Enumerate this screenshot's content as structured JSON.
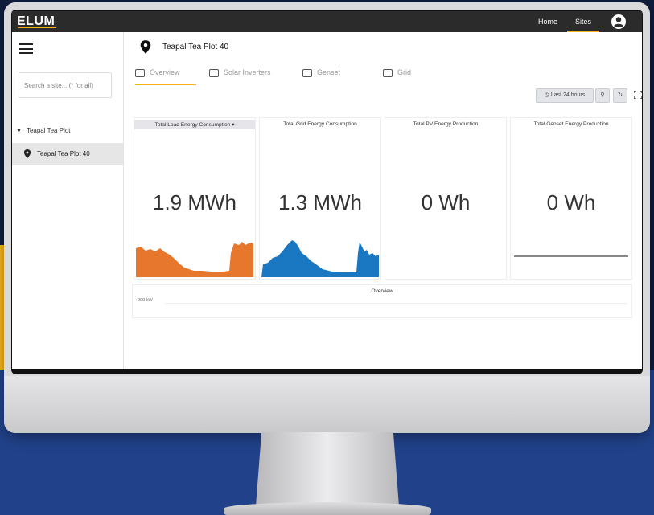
{
  "brand": {
    "logo": "ELUM",
    "accent": "#f6b41c"
  },
  "topnav": {
    "home": "Home",
    "sites": "Sites"
  },
  "sidebar": {
    "search_placeholder": "Search a site... (* for all)",
    "group": "Teapal Tea Plot",
    "item": "Teapal Tea Plot 40"
  },
  "main": {
    "title": "Teapal Tea Plot 40",
    "tabs": [
      {
        "label": "Overview",
        "active": true
      },
      {
        "label": "Solar Inverters",
        "active": false
      },
      {
        "label": "Genset",
        "active": false
      },
      {
        "label": "Grid",
        "active": false
      }
    ],
    "toolbar": {
      "time_range": "Last 24 hours"
    }
  },
  "cards": [
    {
      "title": "Total Load Energy Consumption",
      "value": "1.9 MWh",
      "color": "#e8772e",
      "dropdown": true
    },
    {
      "title": "Total Grid Energy Consumption",
      "value": "1.3 MWh",
      "color": "#1a78c2"
    },
    {
      "title": "Total PV Energy Production",
      "value": "0 Wh"
    },
    {
      "title": "Total Genset Energy Production",
      "value": "0 Wh",
      "color": "#888888"
    }
  ],
  "overview": {
    "title": "Overview",
    "y_tick": "200 kW"
  }
}
